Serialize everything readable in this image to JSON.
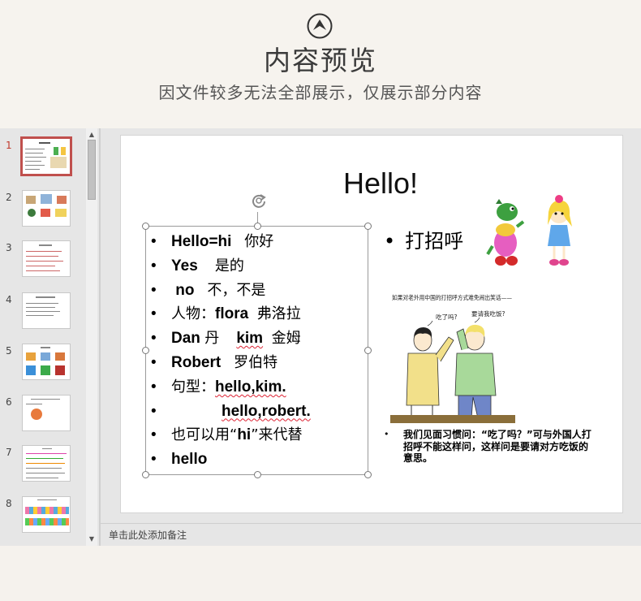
{
  "header": {
    "icon": "chevron-up-circle-icon",
    "title": "内容预览",
    "subtitle": "因文件较多无法全部展示，仅展示部分内容"
  },
  "thumbnails": [
    {
      "number": "1",
      "active": true
    },
    {
      "number": "2",
      "active": false
    },
    {
      "number": "3",
      "active": false
    },
    {
      "number": "4",
      "active": false
    },
    {
      "number": "5",
      "active": false
    },
    {
      "number": "6",
      "active": false
    },
    {
      "number": "7",
      "active": false
    },
    {
      "number": "8",
      "active": false
    }
  ],
  "slide": {
    "title": "Hello!",
    "bullets": {
      "b1_en": "Hello=hi",
      "b1_cn": "你好",
      "b2_en": "Yes",
      "b2_cn": "是的",
      "b3_en": "no",
      "b3_cn": "不，不是",
      "b4_cn": "人物：",
      "b4_en": "flora",
      "b4_cn2": "弗洛拉",
      "b5_en": "Dan",
      "b5_cn": "丹",
      "b5_en2": "kim",
      "b5_cn2": "金姆",
      "b6_en": "Robert",
      "b6_cn": "罗伯特",
      "b7_cn": "句型：",
      "b7_en": "hello,kim.",
      "b8_en": "hello,robert.",
      "b9_a": "也可以用“",
      "b9_b": "hi",
      "b9_c": "”来代替",
      "b10_en": "hello"
    },
    "greeting": "打招呼",
    "comic_caption": "如果对老外用中国的打招呼方式难免闹出笑话——",
    "comic_speech_1": "吃了吗?",
    "comic_speech_2": "要请我吃饭?",
    "note": "我们见面习惯问：“吃了吗？”可与外国人打招呼不能这样问，这样问是要请对方吃饭的意思。"
  },
  "notes_placeholder": "单击此处添加备注",
  "colors": {
    "accent": "#c0504d",
    "background": "#f5f2ed",
    "viewer": "#e6e6e6"
  }
}
